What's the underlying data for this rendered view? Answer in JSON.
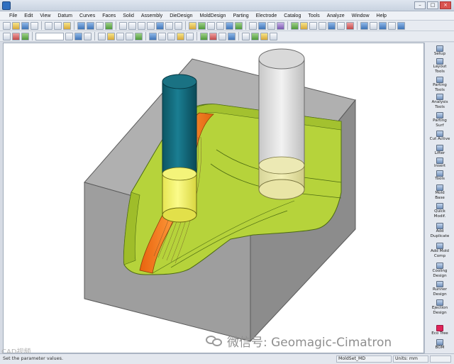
{
  "window": {
    "minimize": "–",
    "maximize": "□",
    "close": "×"
  },
  "menu": [
    "File",
    "Edit",
    "View",
    "Datum",
    "Curves",
    "Faces",
    "Solid",
    "Assembly",
    "DieDesign",
    "MoldDesign",
    "Parting",
    "Electrode",
    "Catalog",
    "Tools",
    "Analyze",
    "Window",
    "Help"
  ],
  "right_panel": [
    {
      "label": "Setup",
      "icon": "setup-icon"
    },
    {
      "label": "Layout\nTools",
      "icon": "layout-tools-icon"
    },
    {
      "label": "Parting\nTools",
      "icon": "parting-tools-icon"
    },
    {
      "label": "Analysis\nTools",
      "icon": "analysis-tools-icon"
    },
    {
      "label": "Parting\nSurf",
      "icon": "parting-surf-icon"
    },
    {
      "label": "Cut Active",
      "icon": "cut-active-icon"
    },
    {
      "label": "Lifter",
      "icon": "lifter-icon"
    },
    {
      "label": "Insert",
      "icon": "insert-icon"
    },
    {
      "label": "Tools",
      "icon": "tools-icon"
    },
    {
      "label": "Mold\nBase",
      "icon": "mold-base-icon"
    },
    {
      "label": "Quick\nModif.",
      "icon": "quick-modif-icon"
    },
    {
      "label": "Add\nDuplicate",
      "icon": "add-duplicate-icon"
    },
    {
      "label": "Add Mold\nComp",
      "icon": "add-mold-comp-icon"
    },
    {
      "label": "Cooling\nDesign",
      "icon": "cooling-design-icon"
    },
    {
      "label": "Runner\nDesign",
      "icon": "runner-design-icon"
    },
    {
      "label": "Ejection\nDesign",
      "icon": "ejection-design-icon"
    },
    {
      "label": "Eco Tree",
      "icon": "eco-tree-icon"
    },
    {
      "label": "BOM",
      "icon": "bom-icon"
    }
  ],
  "watermark": {
    "text": "微信号: Geomagic-Cimatron",
    "corner": "CAD视频"
  },
  "status": {
    "message": "Set the parameter values.",
    "file": "MoldSet_MD",
    "units": "Units: mm"
  },
  "colors": {
    "mold_gray": "#9c9c9c",
    "cavity_green": "#b6d33b",
    "toolpath_orange": "#ff7a1a",
    "tool_teal": "#0f6474",
    "tool_yellow": "#f3f36a",
    "tool_gray": "#dadada"
  }
}
